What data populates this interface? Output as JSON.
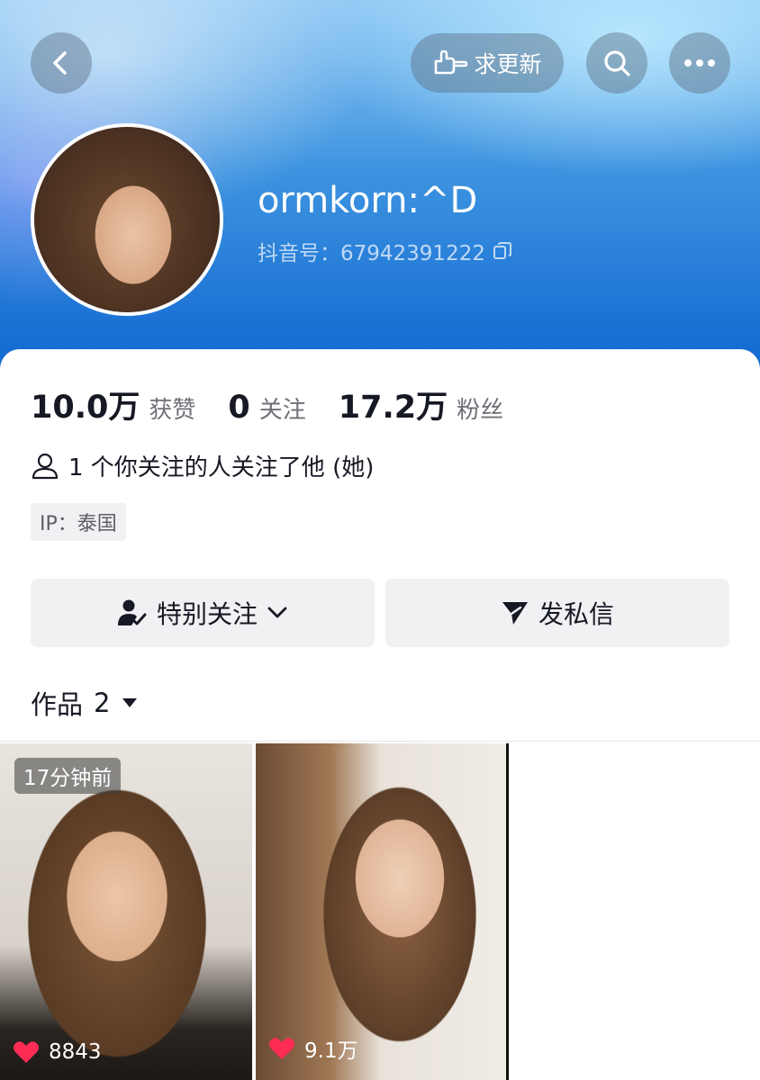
{
  "header": {
    "back_icon": "back-chevron-icon",
    "request_update_label": "求更新",
    "search_icon": "search-icon",
    "more_icon": "more-dots-icon"
  },
  "profile": {
    "username": "ormkorn:^D",
    "douyin_id_label": "抖音号：67942391222"
  },
  "stats": {
    "likes_num": "10.0万",
    "likes_label": "获赞",
    "following_num": "0",
    "following_label": "关注",
    "followers_num": "17.2万",
    "followers_label": "粉丝"
  },
  "mutual_text": "1 个你关注的人关注了他 (她)",
  "ip_text": "IP：泰国",
  "actions": {
    "special_follow": "特别关注",
    "message": "发私信"
  },
  "works": {
    "label": "作品",
    "count": "2",
    "items": [
      {
        "time": "17分钟前",
        "likes": "8843"
      },
      {
        "likes": "9.1万"
      }
    ]
  },
  "colors": {
    "like_heart": "#fe2c55",
    "header_blue": "#0f66d0"
  }
}
